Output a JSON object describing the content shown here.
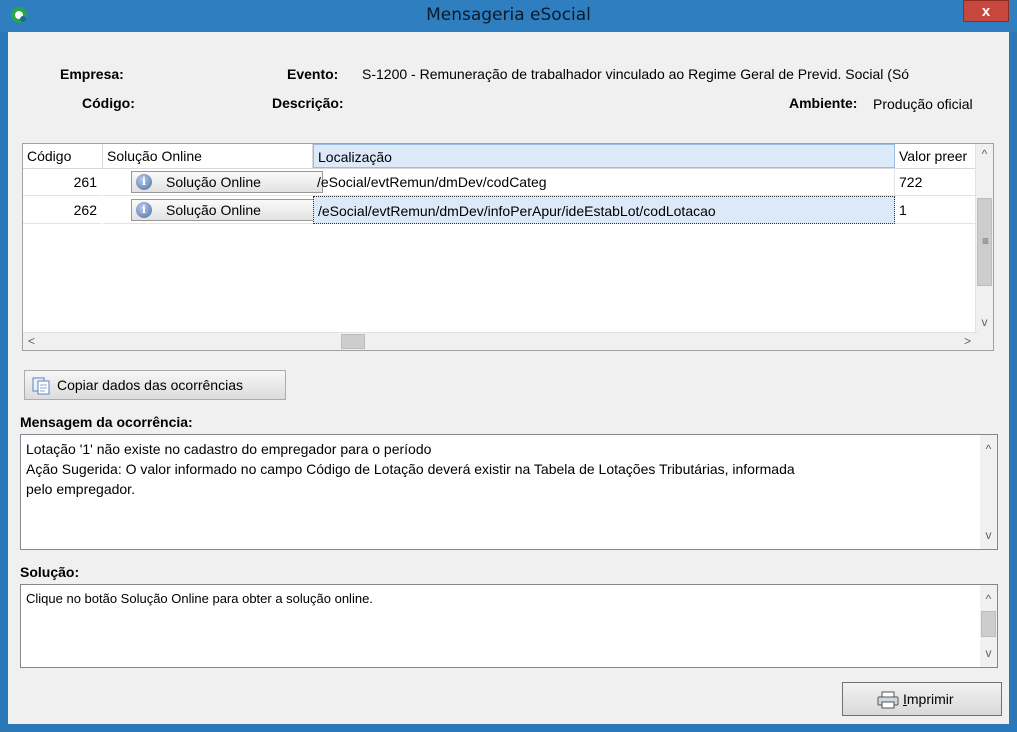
{
  "window": {
    "title": "Mensageria eSocial",
    "close_label": "x"
  },
  "header": {
    "empresa_label": "Empresa:",
    "evento_label": "Evento:",
    "evento_value": "S-1200 - Remuneração de trabalhador vinculado ao Regime Geral de Previd. Social (Só",
    "codigo_label": "Código:",
    "descricao_label": "Descrição:",
    "ambiente_label": "Ambiente:",
    "ambiente_value": "Produção oficial"
  },
  "grid": {
    "columns": [
      "Código",
      "Solução Online",
      "Localização",
      "Valor preer"
    ],
    "rows": [
      {
        "codigo": "261",
        "solucao": "Solução Online",
        "localizacao": "/eSocial/evtRemun/dmDev/codCateg",
        "valor": "722"
      },
      {
        "codigo": "262",
        "solucao": "Solução Online",
        "localizacao": "/eSocial/evtRemun/dmDev/infoPerApur/ideEstabLot/codLotacao",
        "valor": "1"
      }
    ]
  },
  "copy_button": {
    "label": "Copiar dados das ocorrências"
  },
  "mensagem": {
    "label": "Mensagem da ocorrência:",
    "lines": [
      "Lotação '1' não existe no cadastro do empregador para o período",
      "Ação Sugerida: O valor informado no campo Código de Lotação deverá existir na Tabela de Lotações Tributárias, informada",
      "pelo empregador."
    ]
  },
  "solucao": {
    "label": "Solução:",
    "text": "Clique no botão Solução Online para obter a solução online."
  },
  "print_button": {
    "label_underlined": "I",
    "label_rest": "mprimir"
  },
  "scroll_glyphs": {
    "up": "^",
    "down": "v",
    "left": "<",
    "right": ">",
    "grip": "≡"
  },
  "colors": {
    "title_bar": "#2f7fc0",
    "selection": "#dbe9f9",
    "close": "#c7463d"
  },
  "icons": [
    "app-logo-icon",
    "close-icon",
    "info-icon",
    "copy-icon",
    "printer-icon"
  ]
}
